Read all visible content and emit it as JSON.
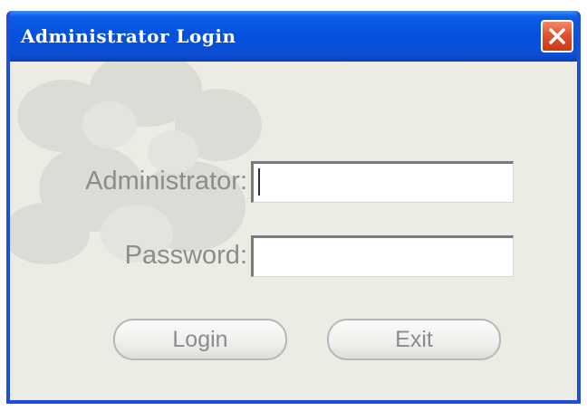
{
  "window": {
    "title": "Administrator Login"
  },
  "form": {
    "admin_label": "Administrator:",
    "admin_value": "",
    "password_label": "Password:",
    "password_value": ""
  },
  "buttons": {
    "login_label": "Login",
    "exit_label": "Exit"
  },
  "icons": {
    "close": "close-icon",
    "watermark": "people-watermark-icon"
  },
  "colors": {
    "titlebar": "#0550dc",
    "close_button": "#e0532f",
    "background": "#ecebe4",
    "label_text": "#8c8c8c"
  }
}
